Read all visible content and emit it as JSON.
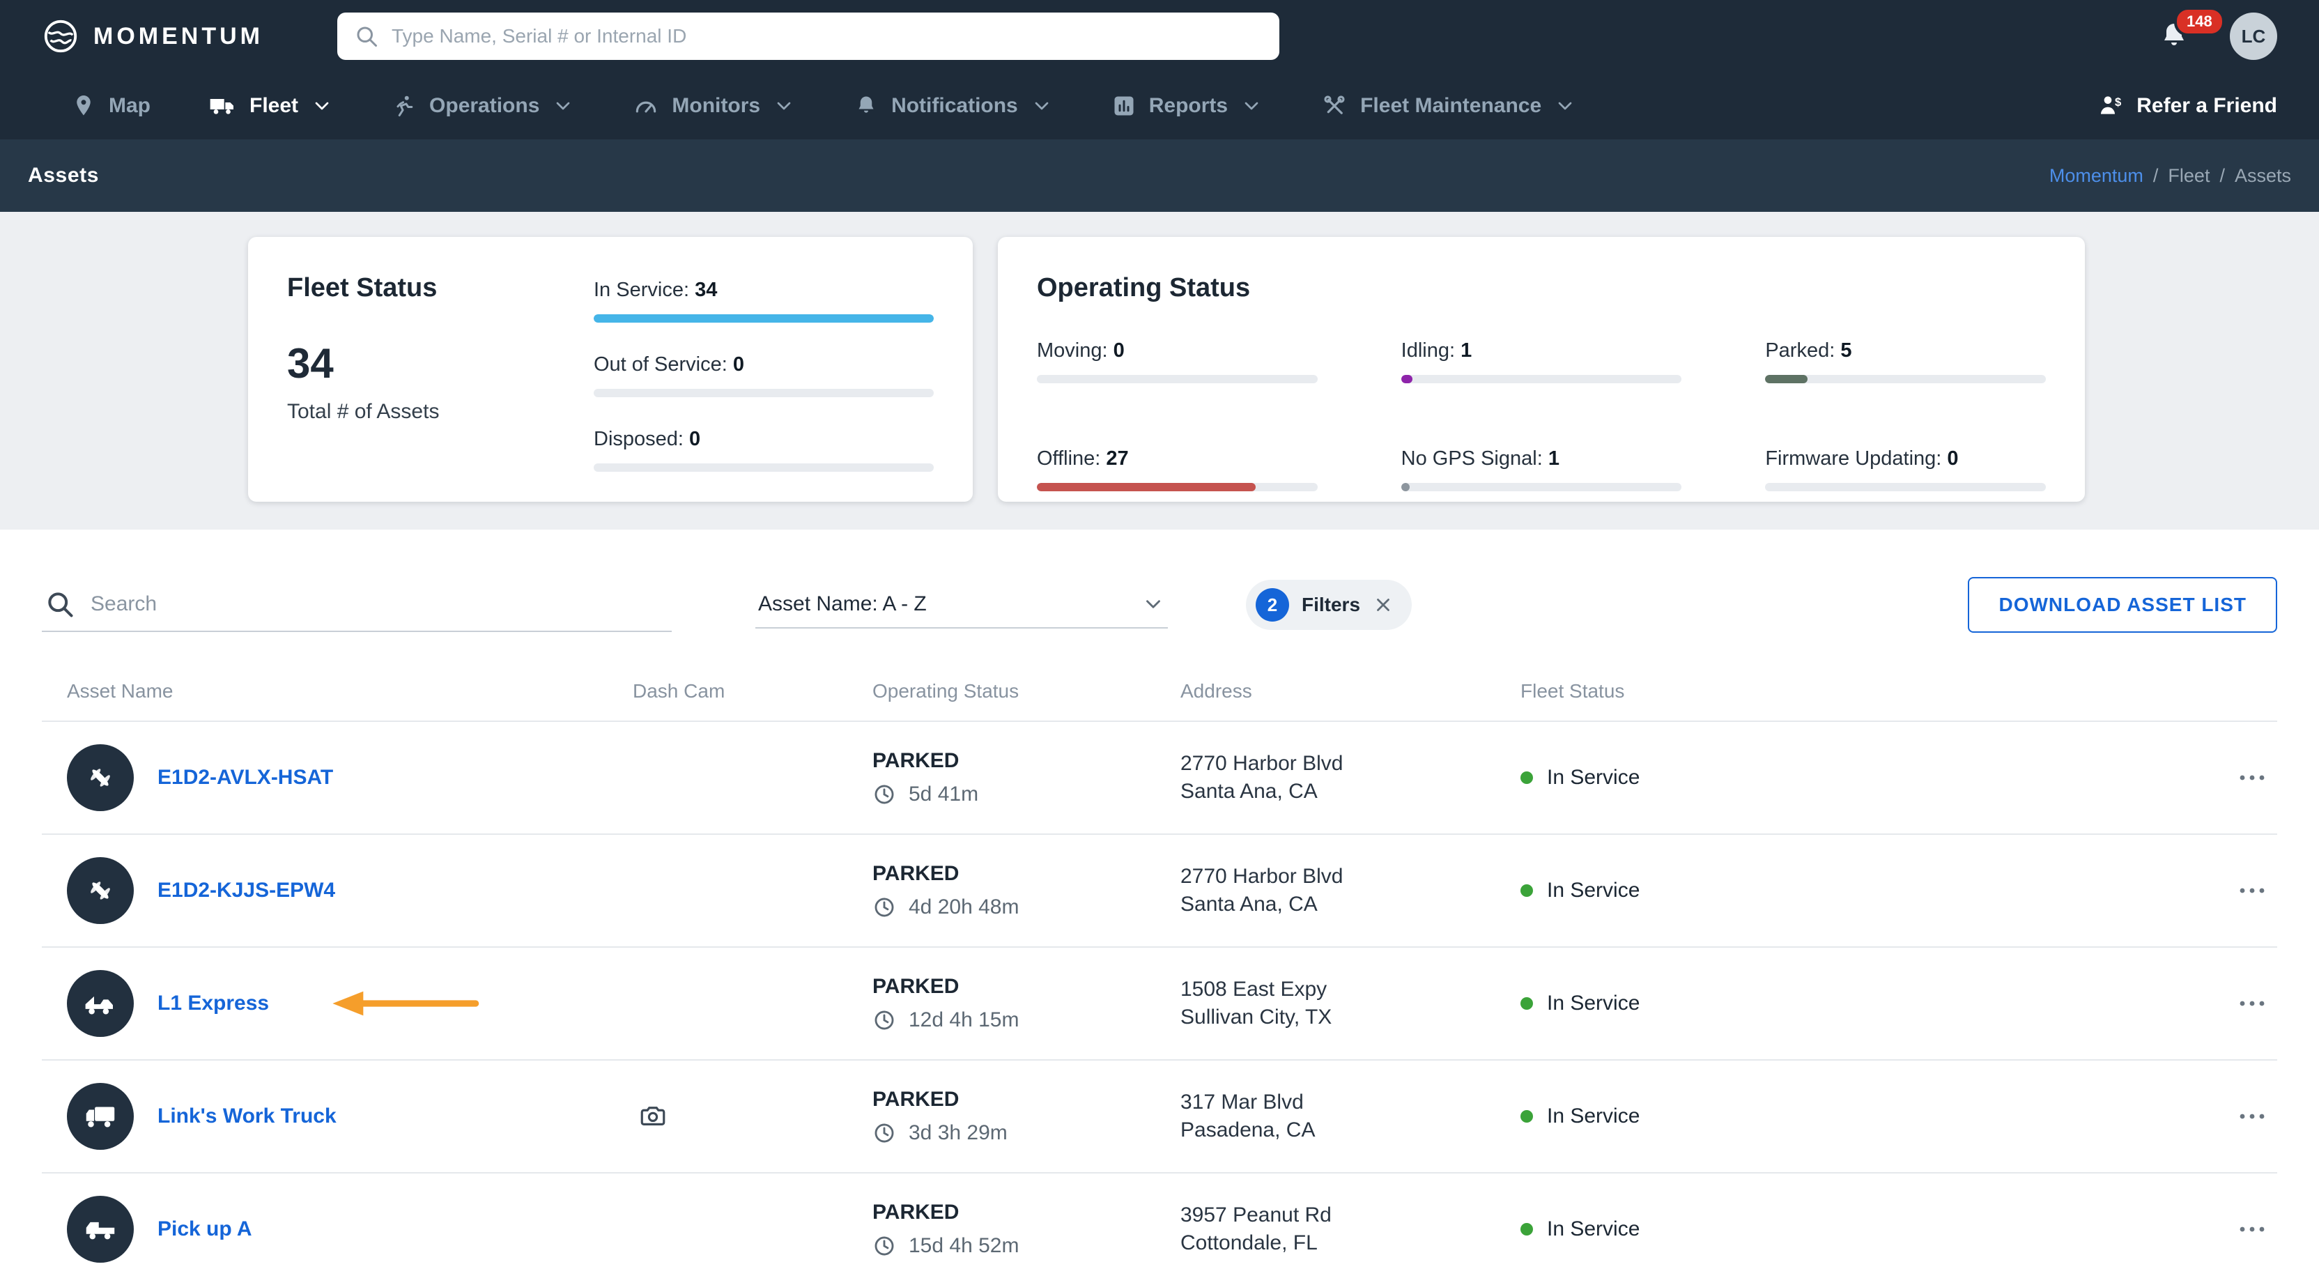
{
  "colors": {
    "accent": "#1565d8",
    "status_green": "#3ba339",
    "badge_red": "#d93025"
  },
  "header": {
    "brand": "MOMENTUM",
    "search": {
      "placeholder": "Type Name, Serial # or Internal ID",
      "icon": "search-icon"
    },
    "notifications": {
      "count": "148",
      "icon": "bell-icon"
    },
    "avatar_initials": "LC"
  },
  "nav": {
    "items": [
      {
        "label": "Map",
        "icon": "map-pin-icon",
        "dropdown": false,
        "active": false
      },
      {
        "label": "Fleet",
        "icon": "truck-icon",
        "dropdown": true,
        "active": true
      },
      {
        "label": "Operations",
        "icon": "runner-icon",
        "dropdown": true,
        "active": false
      },
      {
        "label": "Monitors",
        "icon": "gauge-icon",
        "dropdown": true,
        "active": false
      },
      {
        "label": "Notifications",
        "icon": "bell-icon",
        "dropdown": true,
        "active": false
      },
      {
        "label": "Reports",
        "icon": "bar-chart-icon",
        "dropdown": true,
        "active": false
      },
      {
        "label": "Fleet Maintenance",
        "icon": "tools-icon",
        "dropdown": true,
        "active": false
      }
    ],
    "refer_a_friend": {
      "label": "Refer a Friend",
      "icon": "refer-friend-icon"
    }
  },
  "pagebar": {
    "title": "Assets",
    "separator": "/",
    "breadcrumb": [
      "Momentum",
      "Fleet",
      "Assets"
    ]
  },
  "fleet_status_card": {
    "title": "Fleet Status",
    "total_value": "34",
    "total_label": "Total # of Assets",
    "metrics": [
      {
        "label": "In Service:",
        "value": "34",
        "pct": 100,
        "color": "#45b5e8"
      },
      {
        "label": "Out of Service:",
        "value": "0",
        "pct": 0,
        "color": "#45b5e8"
      },
      {
        "label": "Disposed:",
        "value": "0",
        "pct": 0,
        "color": "#45b5e8"
      }
    ]
  },
  "operating_status_card": {
    "title": "Operating Status",
    "metrics": [
      {
        "label": "Moving:",
        "value": "0",
        "pct": 0,
        "color": "#3ba339"
      },
      {
        "label": "Idling:",
        "value": "1",
        "pct": 4,
        "color": "#8e24aa"
      },
      {
        "label": "Parked:",
        "value": "5",
        "pct": 15,
        "color": "#5e7264"
      },
      {
        "label": "Offline:",
        "value": "27",
        "pct": 78,
        "color": "#c5534f"
      },
      {
        "label": "No GPS Signal:",
        "value": "1",
        "pct": 3,
        "color": "#8d969e"
      },
      {
        "label": "Firmware Updating:",
        "value": "0",
        "pct": 0,
        "color": "#8d969e"
      }
    ]
  },
  "toolbar": {
    "search_placeholder": "Search",
    "sort_value": "Asset Name: A - Z",
    "filters": {
      "count": "2",
      "label": "Filters"
    },
    "download_button": "DOWNLOAD ASSET LIST"
  },
  "table": {
    "columns": [
      "Asset Name",
      "Dash Cam",
      "Operating Status",
      "Address",
      "Fleet Status"
    ],
    "rows": [
      {
        "name": "E1D2-AVLX-HSAT",
        "avatar_icon": "drone-icon",
        "dash_cam": false,
        "status": "PARKED",
        "duration": "5d 41m",
        "address1": "2770 Harbor Blvd",
        "address2": "Santa Ana, CA",
        "fleet_status": "In Service"
      },
      {
        "name": "E1D2-KJJS-EPW4",
        "avatar_icon": "drone-icon",
        "dash_cam": false,
        "status": "PARKED",
        "duration": "4d 20h 48m",
        "address1": "2770 Harbor Blvd",
        "address2": "Santa Ana, CA",
        "fleet_status": "In Service"
      },
      {
        "name": "L1 Express",
        "avatar_icon": "tow-truck-icon",
        "dash_cam": false,
        "status": "PARKED",
        "duration": "12d 4h 15m",
        "address1": "1508 East Expy",
        "address2": "Sullivan City, TX",
        "fleet_status": "In Service"
      },
      {
        "name": "Link's Work Truck",
        "avatar_icon": "box-truck-icon",
        "dash_cam": true,
        "status": "PARKED",
        "duration": "3d 3h 29m",
        "address1": "317 Mar Blvd",
        "address2": "Pasadena, CA",
        "fleet_status": "In Service"
      },
      {
        "name": "Pick up A",
        "avatar_icon": "pickup-truck-icon",
        "dash_cam": false,
        "status": "PARKED",
        "duration": "15d 4h 52m",
        "address1": "3957 Peanut Rd",
        "address2": "Cottondale, FL",
        "fleet_status": "In Service"
      }
    ]
  },
  "annotation": {
    "shape": "left-arrow",
    "color": "#F59E2B",
    "target_row": "L1 Express"
  }
}
